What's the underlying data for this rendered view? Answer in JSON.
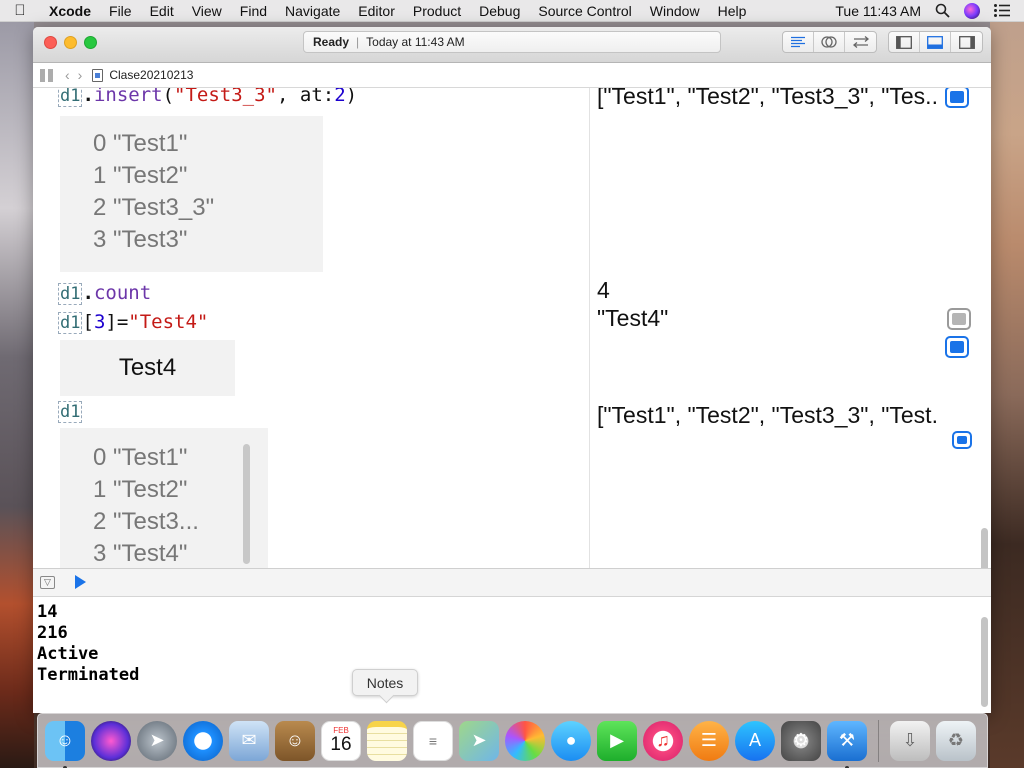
{
  "menubar": {
    "app_name": "Xcode",
    "items": [
      "File",
      "Edit",
      "View",
      "Find",
      "Navigate",
      "Editor",
      "Product",
      "Debug",
      "Source Control",
      "Window",
      "Help"
    ],
    "clock": "Tue 11:43 AM"
  },
  "window": {
    "status": {
      "state": "Ready",
      "time": "Today at 11:43 AM"
    },
    "breadcrumb": "Clase20210213"
  },
  "editor": {
    "line1": {
      "var": "d1",
      "method": "insert",
      "open": "(",
      "str": "\"Test3_3\"",
      "sep": ", ",
      "label": "at:",
      "num": "2",
      "close": ")"
    },
    "box1_rows": [
      "0 \"Test1\"",
      "1 \"Test2\"",
      "2 \"Test3_3\"",
      "3 \"Test3\""
    ],
    "line2": {
      "var": "d1",
      "prop": "count"
    },
    "line3": {
      "var": "d1",
      "open": "[",
      "num": "3",
      "close": "]=",
      "str": "\"Test4\""
    },
    "box2_value": "Test4",
    "line4": {
      "var": "d1"
    },
    "box3_rows": [
      "0 \"Test1\"",
      "1 \"Test2\"",
      "2 \"Test3...",
      "3 \"Test4\""
    ]
  },
  "results": {
    "r1": "[\"Test1\", \"Test2\", \"Test3_3\", \"Tes...",
    "r2": "4",
    "r3": "\"Test4\"",
    "r4": "[\"Test1\", \"Test2\", \"Test3_3\", \"Test..."
  },
  "console": {
    "lines": [
      "14",
      "216",
      "Active",
      "Terminated"
    ]
  },
  "tooltip": "Notes",
  "dock": {
    "icons": [
      "finder-icon",
      "siri-icon",
      "launchpad-icon",
      "safari-icon",
      "mail-icon",
      "contacts-icon",
      "calendar-icon",
      "notes-icon",
      "reminders-icon",
      "maps-icon",
      "photos-icon",
      "messages-icon",
      "facetime-icon",
      "itunes-icon",
      "ibooks-icon",
      "app-store-icon",
      "system-preferences-icon",
      "xcode-icon",
      "downloads-icon",
      "trash-icon"
    ],
    "calendar": {
      "month": "FEB",
      "day": "16"
    }
  }
}
